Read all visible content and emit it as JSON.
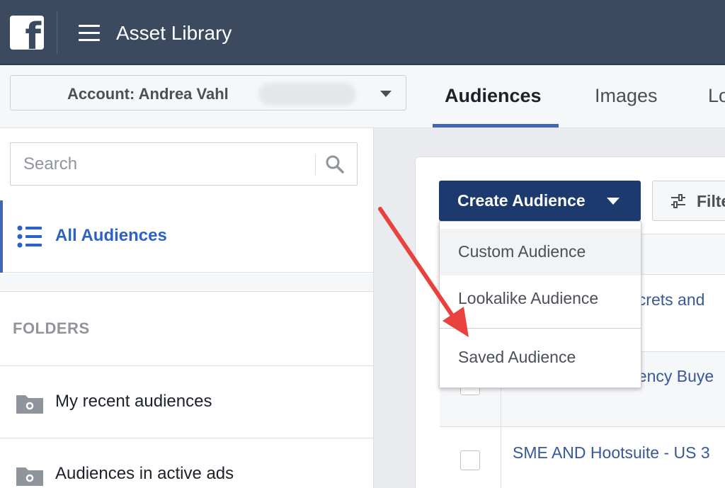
{
  "topbar": {
    "app_title": "Asset Library",
    "logo": "facebook-f-logo",
    "menu_icon": "hamburger-icon"
  },
  "account": {
    "label": "Account: Andrea Vahl"
  },
  "tabs": [
    {
      "label": "Audiences",
      "active": true
    },
    {
      "label": "Images",
      "active": false
    },
    {
      "label": "Lo",
      "active": false
    }
  ],
  "sidebar": {
    "search": {
      "placeholder": "Search",
      "value": ""
    },
    "all_audiences": "All Audiences",
    "folders_heading": "FOLDERS",
    "folders": [
      {
        "label": "My recent audiences"
      },
      {
        "label": "Audiences in active ads"
      }
    ]
  },
  "main": {
    "create_button": "Create Audience",
    "filter_button": "Filte",
    "menu_items": [
      "Custom Audience",
      "Lookalike Audience",
      "Saved Audience"
    ],
    "rows": [
      {
        "name": "ecrets and"
      },
      {
        "name": "gency Buye"
      },
      {
        "name": "SME AND Hootsuite - US 3"
      }
    ]
  },
  "colors": {
    "topbar": "#3b4a5e",
    "create_button": "#1c3a6e",
    "accent_blue": "#4267b2",
    "link": "#385898",
    "annotation_arrow": "#e8413e"
  }
}
